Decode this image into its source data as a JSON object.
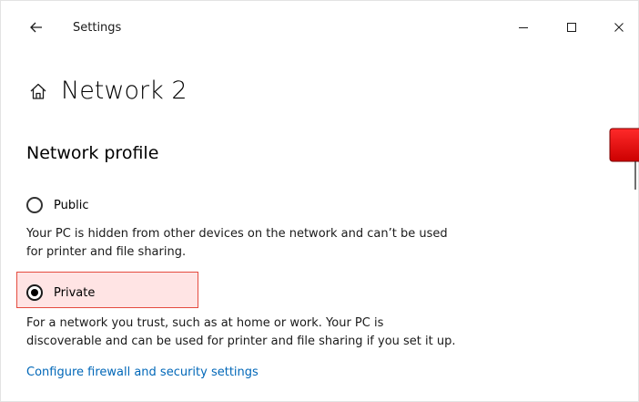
{
  "window": {
    "title": "Settings"
  },
  "page": {
    "title": "Network 2",
    "home_icon": "home-icon"
  },
  "section": {
    "title": "Network profile"
  },
  "options": [
    {
      "label": "Public",
      "selected": false,
      "description_lines": [
        "Your PC is hidden from other devices on the network and can’t be used",
        "for printer and file sharing."
      ]
    },
    {
      "label": "Private",
      "selected": true,
      "description_lines": [
        "For a network you trust, such as at home or work. Your PC is",
        "discoverable and can be used for printer and file sharing if you set it up."
      ]
    }
  ],
  "link": {
    "label": "Configure firewall and security settings"
  },
  "colors": {
    "link": "#0067b8",
    "highlight_border": "#e44b3f",
    "highlight_fill": "#ffd6d6",
    "arrow": "#ff0000"
  },
  "icons": {
    "back": "back-arrow-icon",
    "minimize": "minimize-icon",
    "maximize": "maximize-icon",
    "close": "close-icon"
  }
}
